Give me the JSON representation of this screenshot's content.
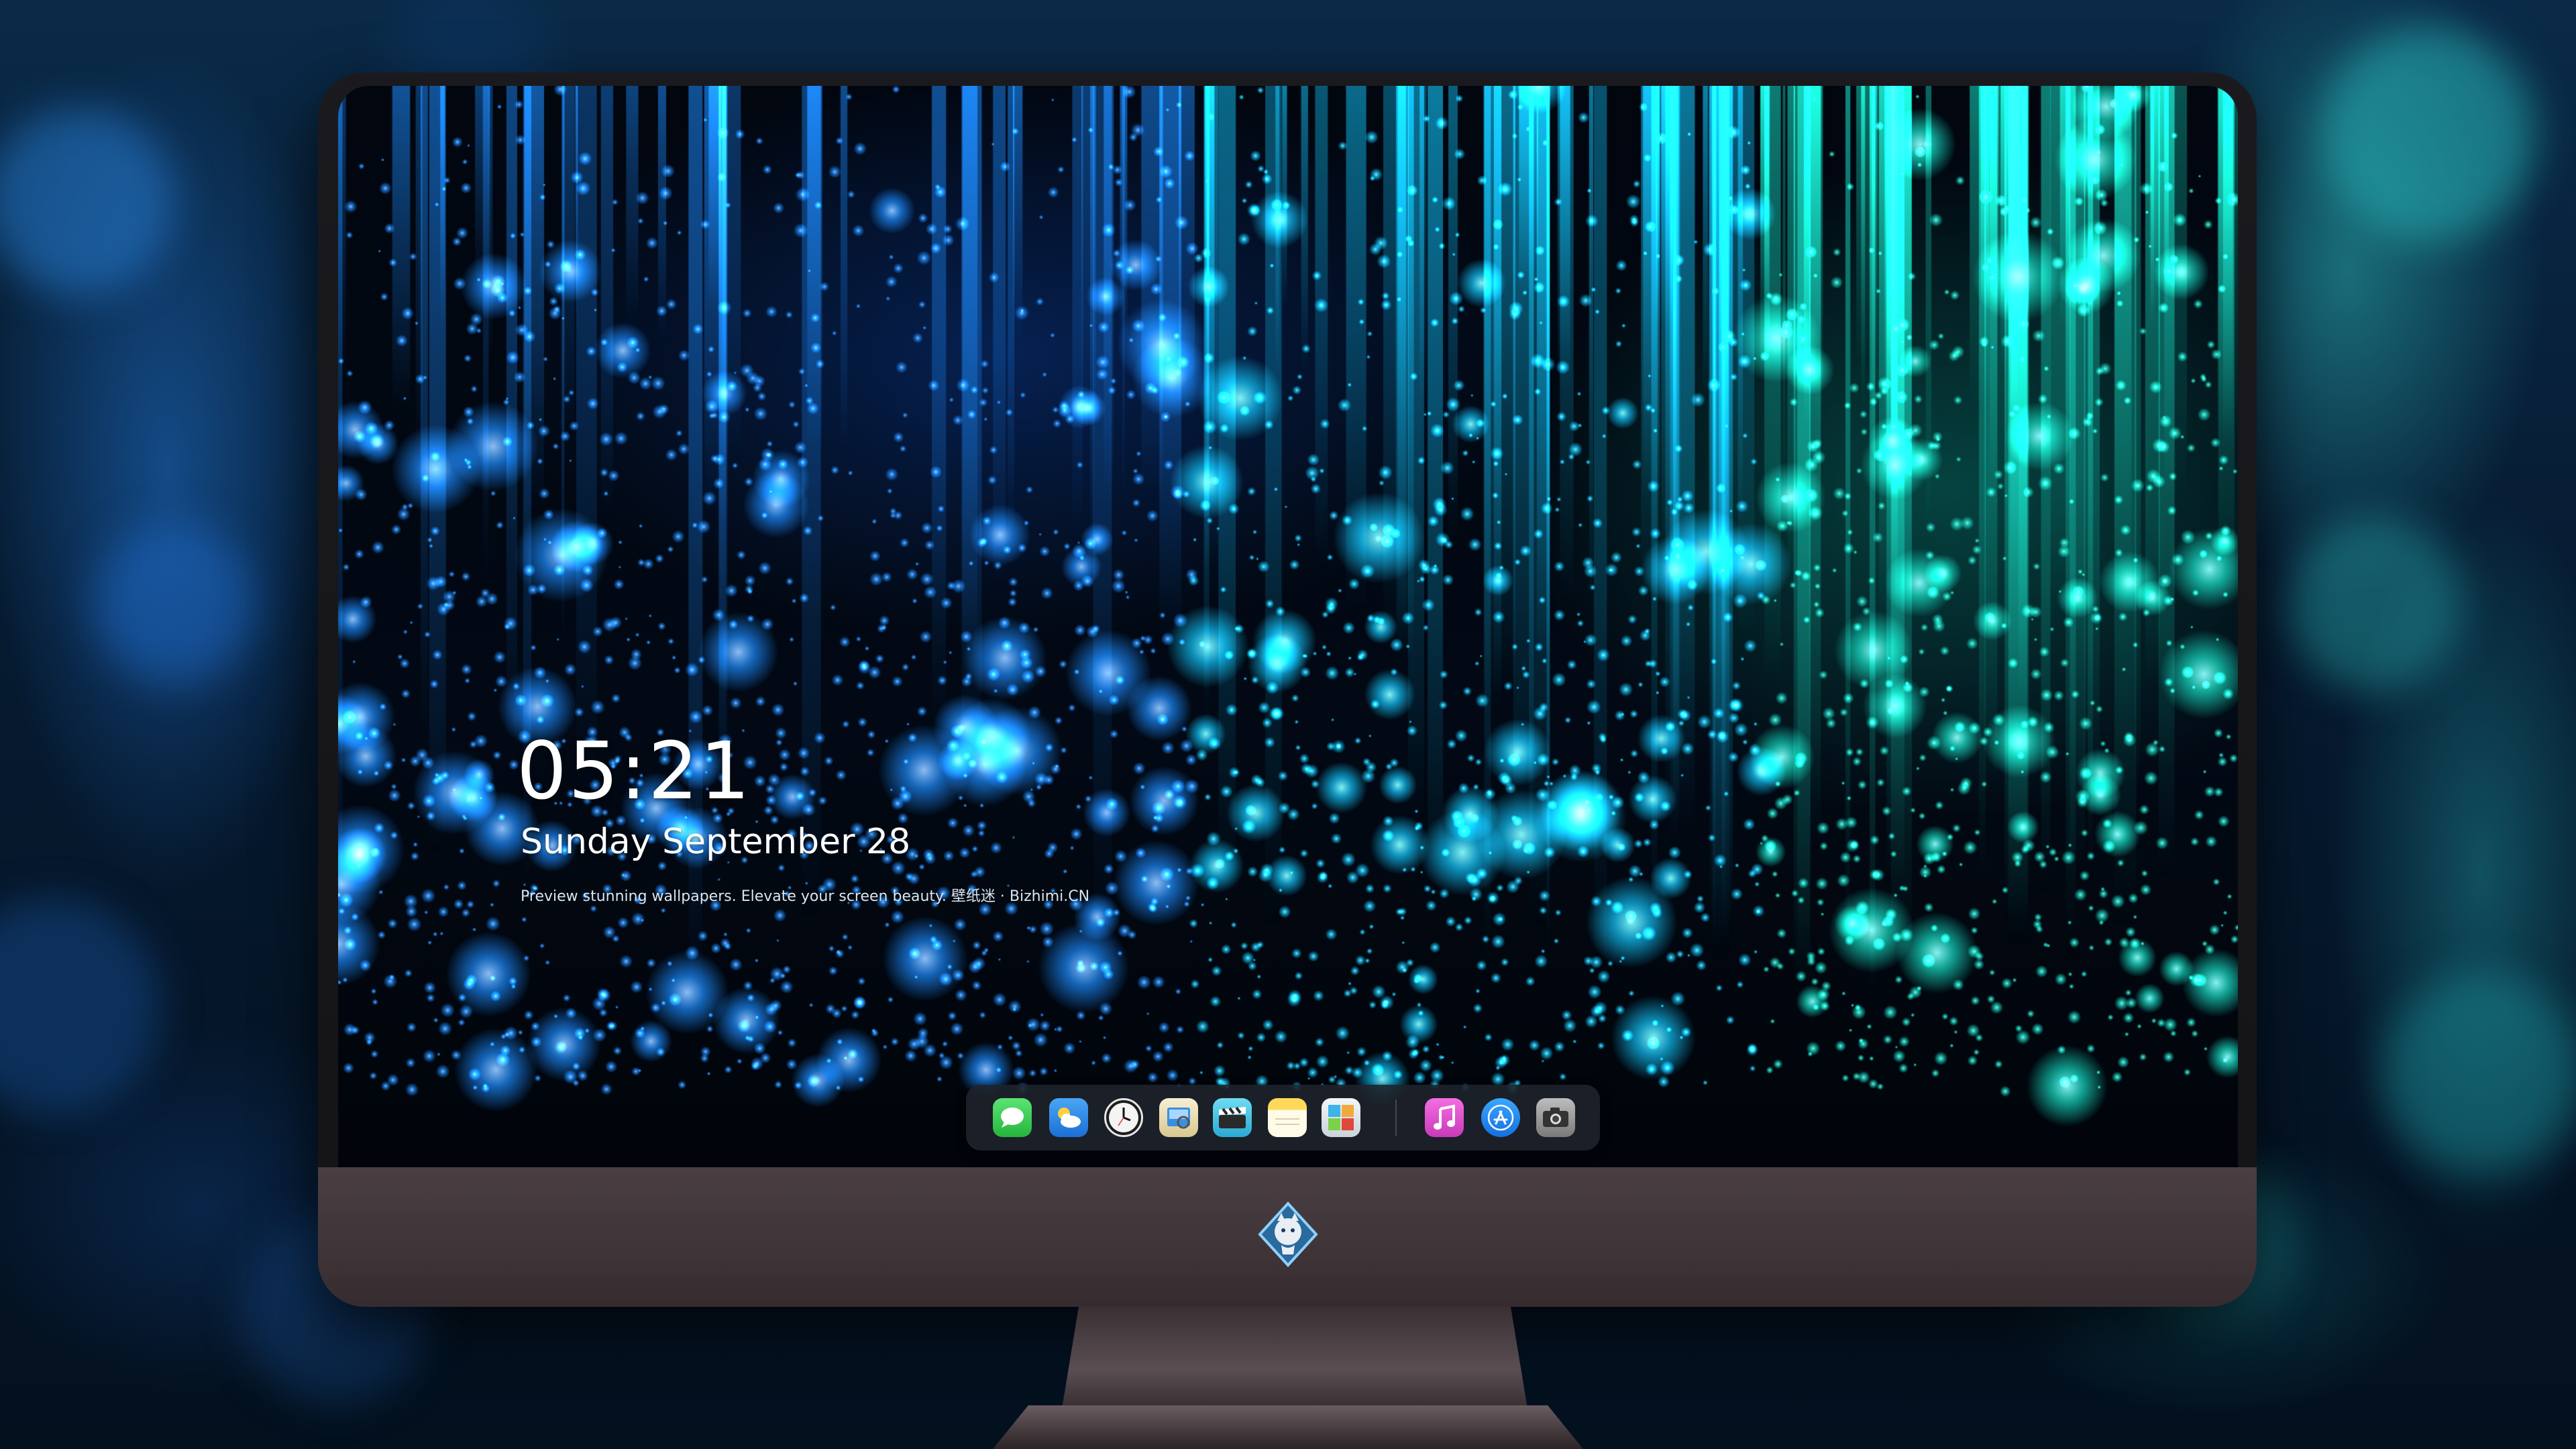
{
  "lockscreen": {
    "time": "05:21",
    "date": "Sunday September  28",
    "tagline": "Preview stunning wallpapers. Elevate your screen beauty. 壁纸迷 · Bizhimi.CN"
  },
  "dock": {
    "apps": [
      {
        "name": "messages-icon",
        "color": "#3fd05a"
      },
      {
        "name": "weather-icon",
        "color": "#3a8ee8"
      },
      {
        "name": "clock-icon",
        "color": "#f2f2f2"
      },
      {
        "name": "preview-icon",
        "color": "#f0e7c4"
      },
      {
        "name": "clips-icon",
        "color": "#62d0e8"
      },
      {
        "name": "notes-icon",
        "color": "#fbd54a"
      },
      {
        "name": "photo-booth-icon",
        "color": "#e9eef2"
      },
      {
        "name": "music-icon",
        "color": "#e94bd6"
      },
      {
        "name": "app-store-icon",
        "color": "#1f8cf2"
      },
      {
        "name": "camera-icon",
        "color": "#9a9a9a"
      }
    ]
  },
  "colors": {
    "particle_blue": "#1a8cff",
    "particle_cyan": "#14d8ff",
    "particle_teal": "#19e0c0",
    "chin": "#433a3e"
  }
}
